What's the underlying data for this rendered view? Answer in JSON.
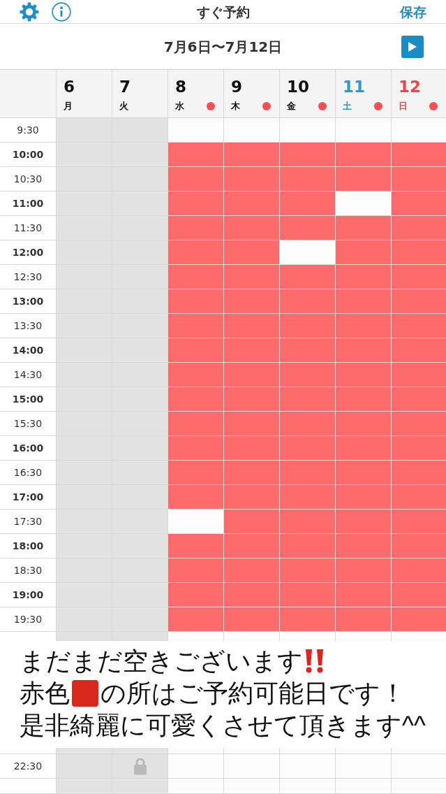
{
  "nav_bar": {
    "title": "すぐ予約",
    "save_button": "保存"
  },
  "week_bar": {
    "range": "7月6日〜7月12日"
  },
  "schedule": {
    "days": [
      {
        "date": "6",
        "weekday": "月",
        "color": "#111111",
        "dot": false,
        "disabled": true
      },
      {
        "date": "7",
        "weekday": "火",
        "color": "#111111",
        "dot": false,
        "disabled": true
      },
      {
        "date": "8",
        "weekday": "水",
        "color": "#111111",
        "dot": true,
        "disabled": false
      },
      {
        "date": "9",
        "weekday": "木",
        "color": "#111111",
        "dot": true,
        "disabled": false
      },
      {
        "date": "10",
        "weekday": "金",
        "color": "#111111",
        "dot": true,
        "disabled": false
      },
      {
        "date": "11",
        "weekday": "土",
        "color": "#2a9ad0",
        "dot": true,
        "disabled": false
      },
      {
        "date": "12",
        "weekday": "日",
        "color": "#e8474f",
        "dot": true,
        "disabled": false
      }
    ],
    "rows": [
      {
        "time": "9:30",
        "kind": "half",
        "selected": [
          false,
          false,
          false,
          false,
          false,
          false,
          false
        ],
        "locked": [
          false,
          false,
          false,
          false,
          false,
          false,
          false
        ]
      },
      {
        "time": "10:00",
        "kind": "hour",
        "selected": [
          false,
          false,
          true,
          true,
          true,
          true,
          true
        ],
        "locked": [
          false,
          false,
          false,
          false,
          false,
          false,
          false
        ]
      },
      {
        "time": "10:30",
        "kind": "half",
        "selected": [
          false,
          false,
          true,
          true,
          true,
          true,
          true
        ],
        "locked": [
          false,
          false,
          false,
          false,
          false,
          false,
          false
        ]
      },
      {
        "time": "11:00",
        "kind": "hour",
        "selected": [
          false,
          false,
          true,
          true,
          true,
          false,
          true
        ],
        "locked": [
          false,
          false,
          false,
          false,
          false,
          false,
          false
        ]
      },
      {
        "time": "11:30",
        "kind": "half",
        "selected": [
          false,
          false,
          true,
          true,
          true,
          true,
          true
        ],
        "locked": [
          false,
          false,
          false,
          false,
          false,
          false,
          false
        ]
      },
      {
        "time": "12:00",
        "kind": "hour",
        "selected": [
          false,
          false,
          true,
          true,
          false,
          true,
          true
        ],
        "locked": [
          false,
          false,
          false,
          false,
          false,
          false,
          false
        ]
      },
      {
        "time": "12:30",
        "kind": "half",
        "selected": [
          false,
          false,
          true,
          true,
          true,
          true,
          true
        ],
        "locked": [
          false,
          false,
          false,
          false,
          false,
          false,
          false
        ]
      },
      {
        "time": "13:00",
        "kind": "hour",
        "selected": [
          false,
          false,
          true,
          true,
          true,
          true,
          true
        ],
        "locked": [
          false,
          false,
          false,
          false,
          false,
          false,
          false
        ]
      },
      {
        "time": "13:30",
        "kind": "half",
        "selected": [
          false,
          false,
          true,
          true,
          true,
          true,
          true
        ],
        "locked": [
          false,
          false,
          false,
          false,
          false,
          false,
          false
        ]
      },
      {
        "time": "14:00",
        "kind": "hour",
        "selected": [
          false,
          false,
          true,
          true,
          true,
          true,
          true
        ],
        "locked": [
          false,
          false,
          false,
          false,
          false,
          false,
          false
        ]
      },
      {
        "time": "14:30",
        "kind": "half",
        "selected": [
          false,
          false,
          true,
          true,
          true,
          true,
          true
        ],
        "locked": [
          false,
          false,
          false,
          false,
          false,
          false,
          false
        ]
      },
      {
        "time": "15:00",
        "kind": "hour",
        "selected": [
          false,
          false,
          true,
          true,
          true,
          true,
          true
        ],
        "locked": [
          false,
          false,
          false,
          false,
          false,
          false,
          false
        ]
      },
      {
        "time": "15:30",
        "kind": "half",
        "selected": [
          false,
          false,
          true,
          true,
          true,
          true,
          true
        ],
        "locked": [
          false,
          false,
          false,
          false,
          false,
          false,
          false
        ]
      },
      {
        "time": "16:00",
        "kind": "hour",
        "selected": [
          false,
          false,
          true,
          true,
          true,
          true,
          true
        ],
        "locked": [
          false,
          false,
          false,
          false,
          false,
          false,
          false
        ]
      },
      {
        "time": "16:30",
        "kind": "half",
        "selected": [
          false,
          false,
          true,
          true,
          true,
          true,
          true
        ],
        "locked": [
          false,
          false,
          false,
          false,
          false,
          false,
          false
        ]
      },
      {
        "time": "17:00",
        "kind": "hour",
        "selected": [
          false,
          false,
          true,
          true,
          true,
          true,
          true
        ],
        "locked": [
          false,
          false,
          false,
          false,
          false,
          false,
          false
        ]
      },
      {
        "time": "17:30",
        "kind": "half",
        "selected": [
          false,
          false,
          false,
          true,
          true,
          true,
          true
        ],
        "locked": [
          false,
          false,
          false,
          false,
          false,
          false,
          false
        ]
      },
      {
        "time": "18:00",
        "kind": "hour",
        "selected": [
          false,
          false,
          true,
          true,
          true,
          true,
          true
        ],
        "locked": [
          false,
          false,
          false,
          false,
          false,
          false,
          false
        ]
      },
      {
        "time": "18:30",
        "kind": "half",
        "selected": [
          false,
          false,
          true,
          true,
          true,
          true,
          true
        ],
        "locked": [
          false,
          false,
          false,
          false,
          false,
          false,
          false
        ]
      },
      {
        "time": "19:00",
        "kind": "hour",
        "selected": [
          false,
          false,
          true,
          true,
          true,
          true,
          true
        ],
        "locked": [
          false,
          false,
          false,
          false,
          false,
          false,
          false
        ]
      },
      {
        "time": "19:30",
        "kind": "half",
        "selected": [
          false,
          false,
          true,
          true,
          true,
          true,
          true
        ],
        "locked": [
          false,
          false,
          false,
          false,
          false,
          false,
          false
        ]
      }
    ],
    "notice": {
      "lines": [
        {
          "parts": [
            {
              "kind": "text",
              "text": "まだまだ空きございます"
            },
            {
              "kind": "double-exclamation"
            }
          ]
        },
        {
          "parts": [
            {
              "kind": "text",
              "text": "赤色"
            },
            {
              "kind": "red-square"
            },
            {
              "kind": "text",
              "text": "の所はご予約可能日です！"
            }
          ]
        },
        {
          "parts": [
            {
              "kind": "text",
              "text": "是非綺麗に可愛くさせて頂きます^^"
            }
          ]
        }
      ]
    },
    "rows_after_notice": [
      {
        "time": "22:30",
        "kind": "half",
        "selected": [
          false,
          false,
          false,
          false,
          false,
          false,
          false
        ],
        "locked": [
          false,
          true,
          false,
          false,
          false,
          false,
          false
        ]
      }
    ]
  }
}
